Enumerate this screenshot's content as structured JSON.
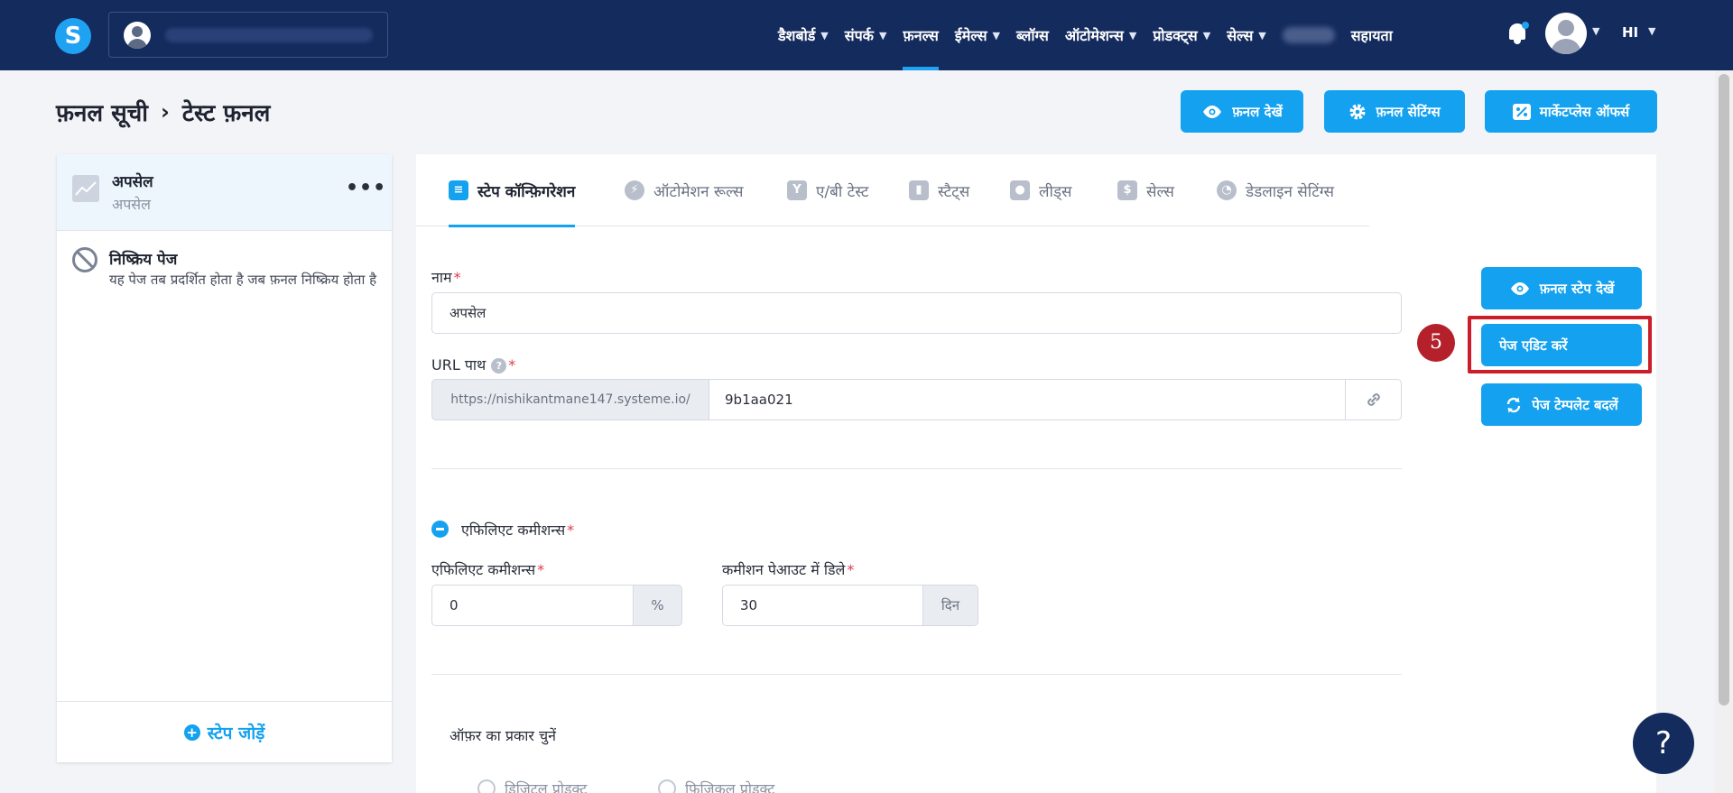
{
  "nav": {
    "items": [
      {
        "label": "डैशबोर्ड",
        "has_menu": true
      },
      {
        "label": "संपर्क",
        "has_menu": true
      },
      {
        "label": "फ़नल्स",
        "has_menu": false,
        "active": true
      },
      {
        "label": "ईमेल्स",
        "has_menu": true
      },
      {
        "label": "ब्लॉग्स",
        "has_menu": false
      },
      {
        "label": "ऑटोमेशन्स",
        "has_menu": true
      },
      {
        "label": "प्रोडक्ट्स",
        "has_menu": true
      },
      {
        "label": "सेल्स",
        "has_menu": true
      }
    ],
    "help": "सहायता",
    "language": "HI",
    "chevron": "⌄"
  },
  "breadcrumb": {
    "parent": "फ़नल सूची",
    "separator": "›",
    "current": "टेस्ट फ़नल"
  },
  "header_buttons": {
    "view_funnel": "फ़नल देखें",
    "funnel_settings": "फ़नल सेटिंग्स",
    "marketplace_offers": "मार्केटप्लेस ऑफर्स"
  },
  "sidebar": {
    "active_step": {
      "title": "अपसेल",
      "subtitle": "अपसेल",
      "more": "•••"
    },
    "inactive_page": {
      "title": "निष्क्रिय पेज",
      "description": "यह पेज तब प्रदर्शित होता है जब फ़नल निष्क्रिय होता है"
    },
    "add_step": "स्टेप जोड़ें"
  },
  "tabs": [
    {
      "label": "स्टेप कॉन्फ़िगरेशन",
      "active": true
    },
    {
      "label": "ऑटोमेशन रूल्स"
    },
    {
      "label": "ए/बी टेस्ट"
    },
    {
      "label": "स्टैट्स"
    },
    {
      "label": "लीड्स"
    },
    {
      "label": "सेल्स"
    },
    {
      "label": "डेडलाइन सेटिंग्स"
    }
  ],
  "form": {
    "name_label": "नाम",
    "name_value": "अपसेल",
    "url_label": "URL पाथ",
    "url_prefix": "https://nishikantmane147.systeme.io/",
    "url_value": "9b1aa021",
    "affiliate_section": "एफिलिएट कमीशन्स",
    "commission_label": "एफिलिएट कमीशन्स",
    "commission_value": "0",
    "commission_unit": "%",
    "payout_label": "कमीशन पेआउट में डिले",
    "payout_value": "30",
    "payout_unit": "दिन",
    "offer_type_label": "ऑफ़र का प्रकार चुनें",
    "offer_digital": "डिजिटल प्रोडक्ट",
    "offer_physical": "फ़िज़िकल प्रोडक्ट",
    "required_mark": "*",
    "help_mark": "?"
  },
  "side_actions": {
    "view_step": "फ़नल स्टेप देखें",
    "edit_page": "पेज एडिट करें",
    "change_template": "पेज टेम्पलेट बदलें"
  },
  "annotation": {
    "step_number": "5"
  },
  "help_fab": "?",
  "colors": {
    "nav_bg": "#142b5e",
    "accent": "#13a1f0",
    "highlight": "#cc1e29"
  }
}
